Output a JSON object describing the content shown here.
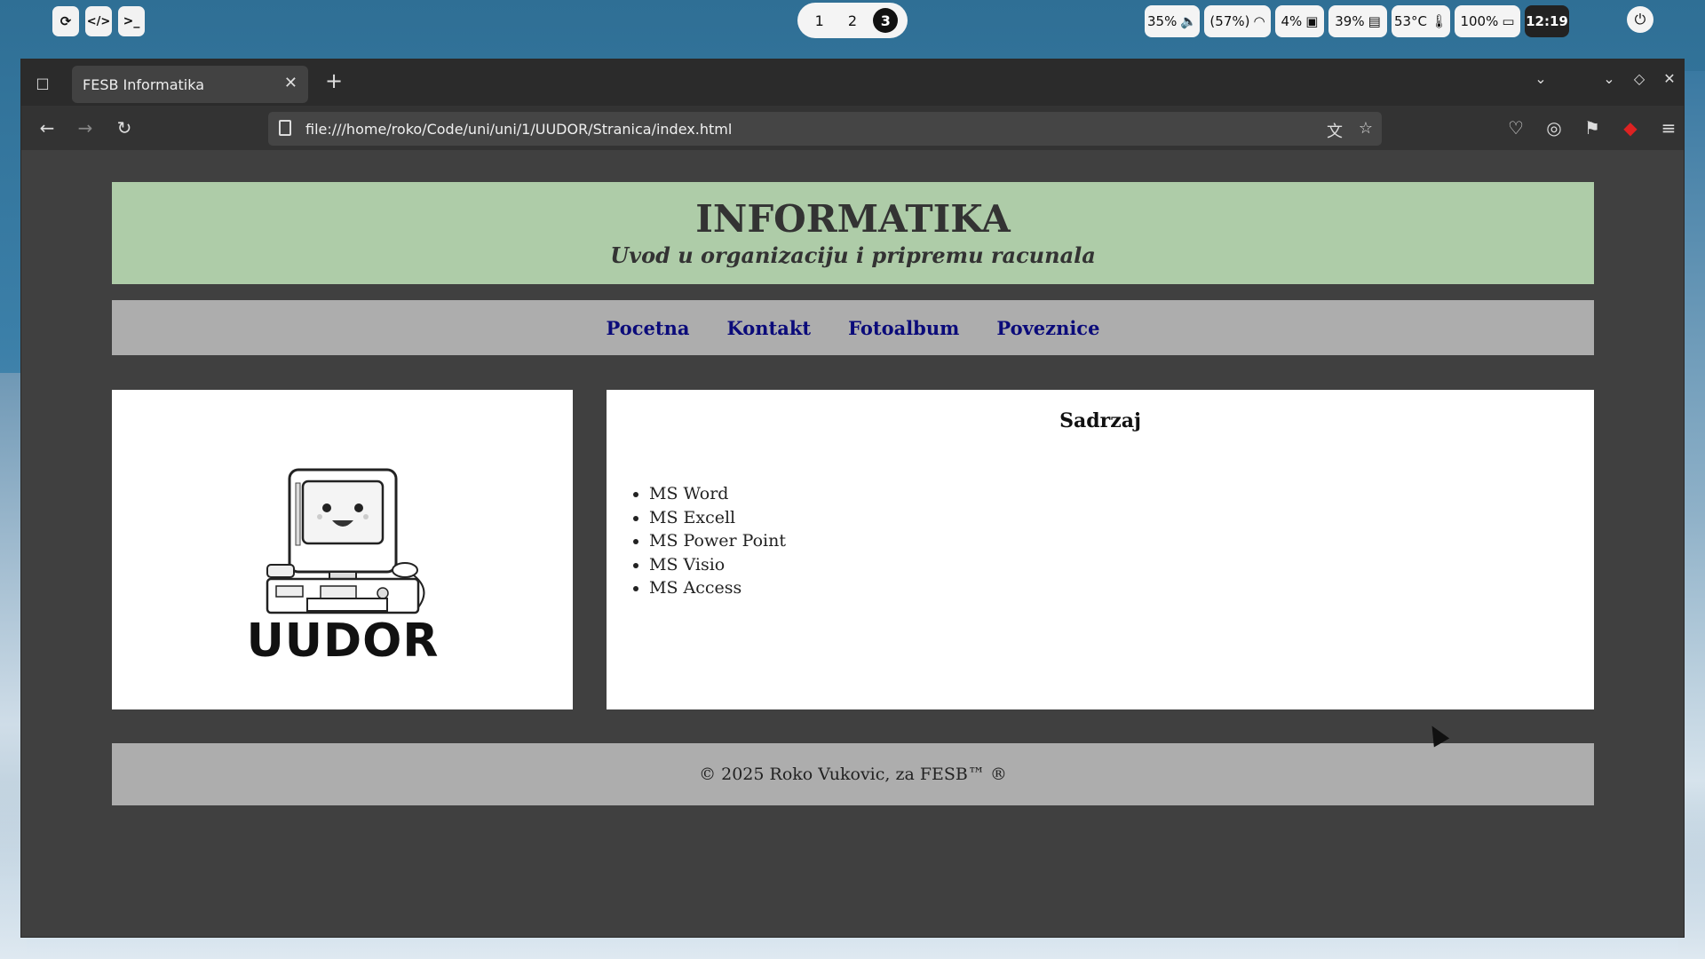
{
  "system_bar": {
    "workspaces": [
      "1",
      "2",
      "3"
    ],
    "active_workspace": "3",
    "volume": "35%",
    "wifi": "(57%)",
    "cpu": "4%",
    "memory": "39%",
    "temperature": "53°C",
    "battery": "100%",
    "time": "12:19"
  },
  "browser": {
    "tab_title": "FESB Informatika",
    "url": "file:///home/roko/Code/uni/uni/1/UUDOR/Stranica/index.html"
  },
  "site": {
    "title": "INFORMATIKA",
    "subtitle": "Uvod u organizaciju i pripremu racunala",
    "nav": [
      "Pocetna",
      "Kontakt",
      "Fotoalbum",
      "Poveznice"
    ],
    "logo_text": "UUDOR",
    "content_title": "Sadrzaj",
    "content_items": [
      "MS Word",
      "MS Excell",
      "MS Power Point",
      "MS Visio",
      "MS Access"
    ],
    "footer": "© 2025 Roko Vukovic, za FESB™ ®"
  },
  "colors": {
    "header_bg": "#aecca8",
    "nav_bg": "#adadad",
    "nav_link": "#0b0b7a",
    "page_bg": "#404040"
  }
}
